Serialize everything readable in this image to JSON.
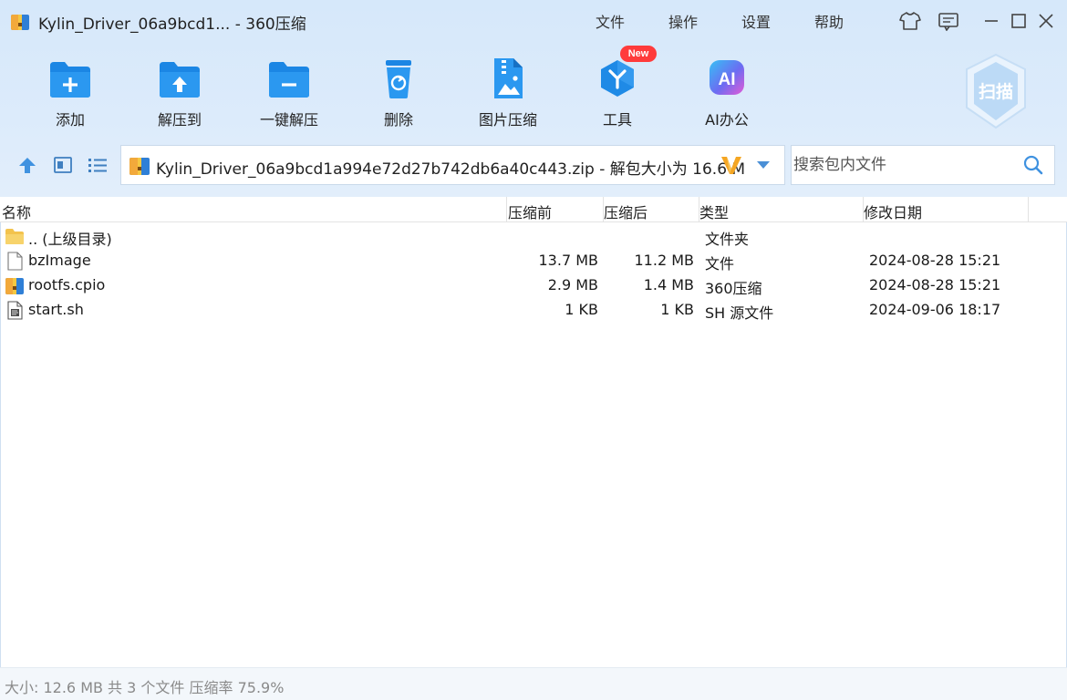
{
  "window": {
    "title": "Kylin_Driver_06a9bcd1... - 360压缩",
    "menu": [
      "文件",
      "操作",
      "设置",
      "帮助"
    ]
  },
  "toolbar": {
    "items": [
      {
        "label": "添加",
        "icon": "add-folder-icon"
      },
      {
        "label": "解压到",
        "icon": "extract-to-icon"
      },
      {
        "label": "一键解压",
        "icon": "one-click-extract-icon"
      },
      {
        "label": "删除",
        "icon": "trash-icon"
      },
      {
        "label": "图片压缩",
        "icon": "image-compress-icon"
      },
      {
        "label": "工具",
        "icon": "tools-icon"
      },
      {
        "label": "AI办公",
        "icon": "ai-office-icon"
      }
    ],
    "new_badge": "New",
    "scan_label": "扫描"
  },
  "address": {
    "path": "Kylin_Driver_06a9bcd1a994e72d27b742db6a40c443.zip - 解包大小为 16.6 M"
  },
  "search": {
    "placeholder": "搜索包内文件"
  },
  "columns": {
    "name": "名称",
    "compressed_before": "压缩前",
    "compressed_after": "压缩后",
    "type": "类型",
    "modified": "修改日期"
  },
  "files": [
    {
      "name": ".. (上级目录)",
      "before": "",
      "after": "",
      "type": "文件夹",
      "date": "",
      "icon": "folder-icon"
    },
    {
      "name": "bzImage",
      "before": "13.7 MB",
      "after": "11.2 MB",
      "type": "文件",
      "date": "2024-08-28 15:21",
      "icon": "file-icon"
    },
    {
      "name": "rootfs.cpio",
      "before": "2.9 MB",
      "after": "1.4 MB",
      "type": "360压缩",
      "date": "2024-08-28 15:21",
      "icon": "archive-icon"
    },
    {
      "name": "start.sh",
      "before": "1 KB",
      "after": "1 KB",
      "type": "SH 源文件",
      "date": "2024-09-06 18:17",
      "icon": "script-file-icon"
    }
  ],
  "status": "大小: 12.6 MB 共 3 个文件 压缩率 75.9%",
  "colors": {
    "accent": "#1f8ae6",
    "toolbar_bg": "#d6e8fa"
  }
}
